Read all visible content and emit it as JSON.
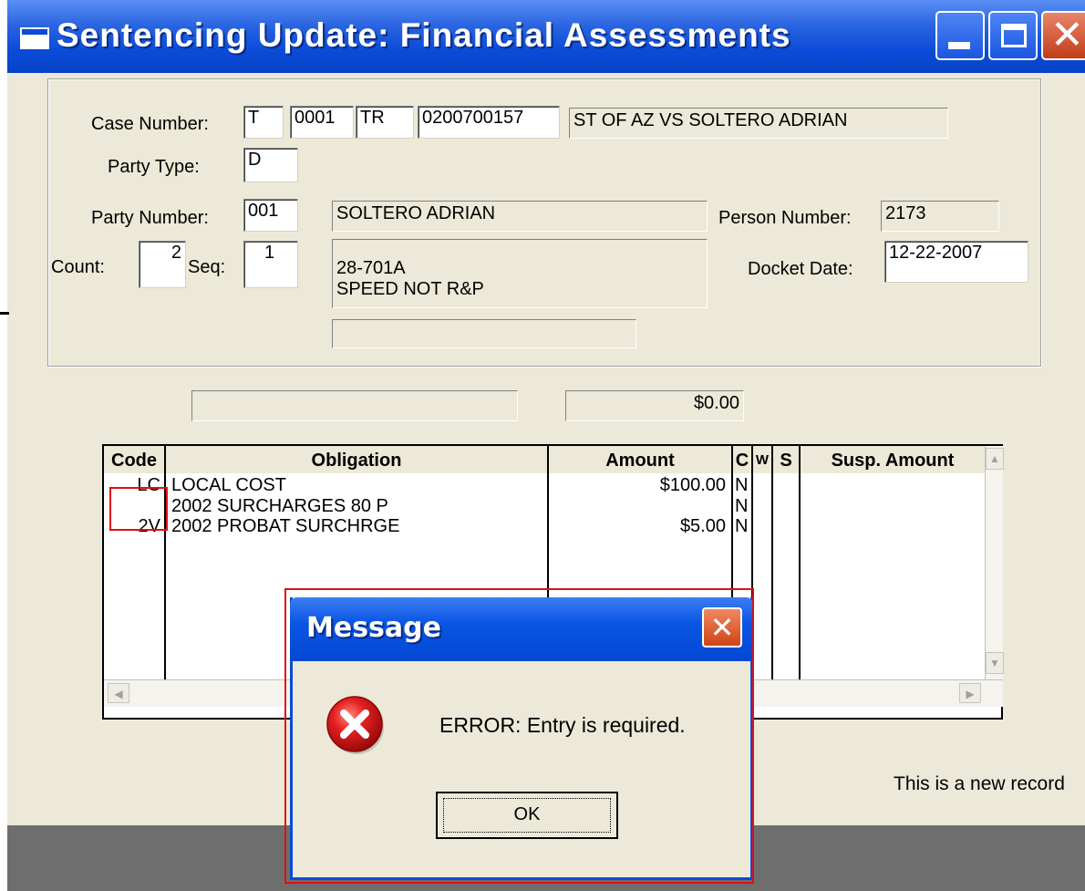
{
  "window": {
    "title": "Sentencing Update: Financial Assessments",
    "close_glyph": "✕"
  },
  "case": {
    "label": "Case Number:",
    "part1": "T",
    "part2": "0001",
    "part3": "TR",
    "part4": "0200700157",
    "caption": "ST OF AZ  VS SOLTERO ADRIAN"
  },
  "party": {
    "type_label": "Party Type:",
    "type": "D",
    "number_label": "Party Number:",
    "number": "001",
    "name": "SOLTERO ADRIAN",
    "person_number_label": "Person Number:",
    "person_number": "2173"
  },
  "count": {
    "count_label": "Count:",
    "count": "2",
    "seq_label": "Seq:",
    "seq": "1",
    "statute": "28-701A",
    "description": "SPEED NOT R&P",
    "docket_label": "Docket Date:",
    "docket_date": "12-22-2007"
  },
  "totals": {
    "blank": "",
    "amount": "$0.00"
  },
  "grid": {
    "headers": [
      "Code",
      "Obligation",
      "Amount",
      "C",
      "W",
      "S",
      "Susp. Amount"
    ],
    "rows": [
      {
        "code": "LC",
        "obligation": "LOCAL COST",
        "amount": "$100.00",
        "c": "N"
      },
      {
        "code": "",
        "obligation": "2002 SURCHARGES 80 P",
        "amount": "",
        "c": "N"
      },
      {
        "code": "2V",
        "obligation": "2002 PROBAT SURCHRGE",
        "amount": "$5.00",
        "c": "N"
      }
    ]
  },
  "message": {
    "title": "Message",
    "close_glyph": "✕",
    "text": "ERROR: Entry is required.",
    "ok_label": "OK"
  },
  "status": "This is a new record",
  "colors": {
    "titlebar": "#0a4bd8",
    "error_red": "#e01010",
    "window_bg": "#ece9d8"
  }
}
